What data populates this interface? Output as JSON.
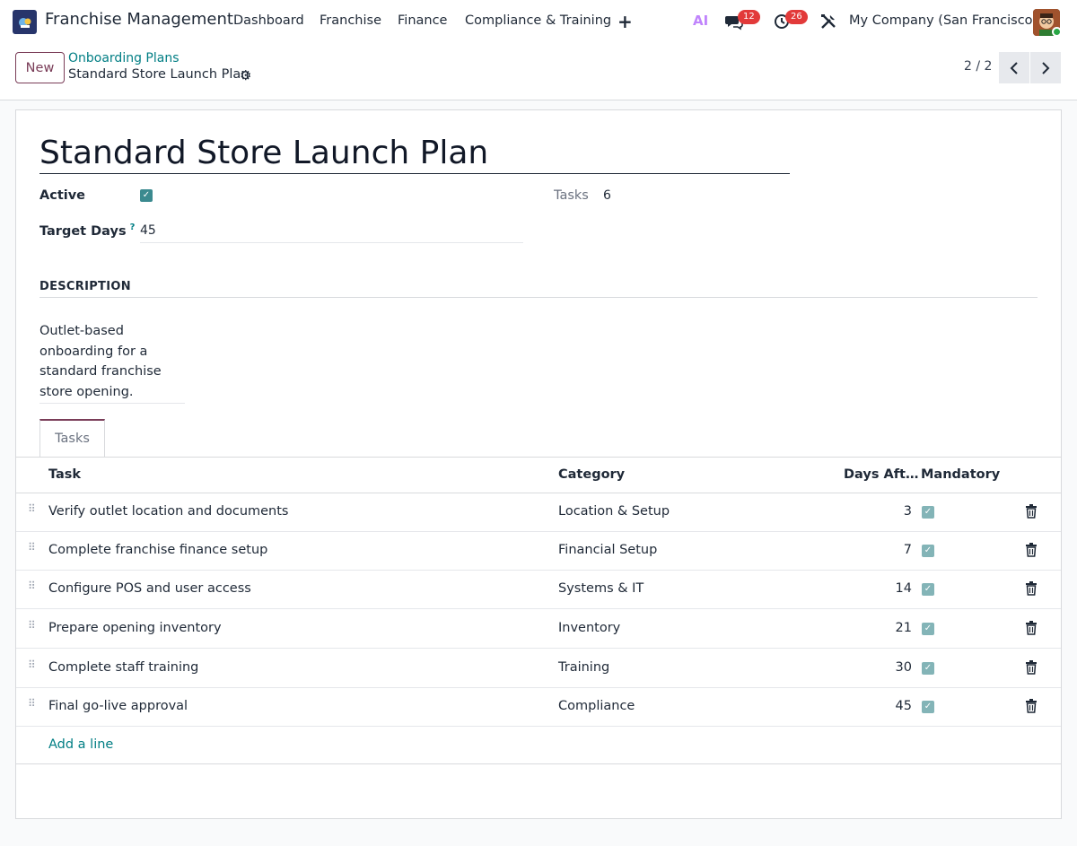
{
  "nav": {
    "app_name": "Franchise Management",
    "menu": [
      "Dashboard",
      "Franchise",
      "Finance",
      "Compliance & Training"
    ],
    "ai_label": "AI",
    "messages_badge": "12",
    "activities_badge": "26",
    "company": "My Company (San Francisco)"
  },
  "control": {
    "new_label": "New",
    "breadcrumb_parent": "Onboarding Plans",
    "breadcrumb_current": "Standard Store Launch Plan",
    "pager": "2 / 2"
  },
  "form": {
    "title": "Standard Store Launch Plan",
    "active_label": "Active",
    "active": true,
    "target_days_label": "Target Days",
    "target_days_help": "?",
    "target_days": "45",
    "tasks_label": "Tasks",
    "tasks_count": "6",
    "description_heading": "DESCRIPTION",
    "description": "Outlet-based onboarding for a standard franchise store opening.",
    "tab_label": "Tasks"
  },
  "list": {
    "columns": {
      "task": "Task",
      "category": "Category",
      "days": "Days Aft…",
      "mandatory": "Mandatory"
    },
    "rows": [
      {
        "task": "Verify outlet location and documents",
        "category": "Location & Setup",
        "days": "3",
        "mandatory": true
      },
      {
        "task": "Complete franchise finance setup",
        "category": "Financial Setup",
        "days": "7",
        "mandatory": true
      },
      {
        "task": "Configure POS and user access",
        "category": "Systems & IT",
        "days": "14",
        "mandatory": true
      },
      {
        "task": "Prepare opening inventory",
        "category": "Inventory",
        "days": "21",
        "mandatory": true
      },
      {
        "task": "Complete staff training",
        "category": "Training",
        "days": "30",
        "mandatory": true
      },
      {
        "task": "Final go-live approval",
        "category": "Compliance",
        "days": "45",
        "mandatory": true
      }
    ],
    "add_line": "Add a line"
  },
  "colors": {
    "accent": "#7a3d58",
    "link": "#017e84",
    "badge": "#e23a3a",
    "checkbox": "#3b8a8f"
  }
}
